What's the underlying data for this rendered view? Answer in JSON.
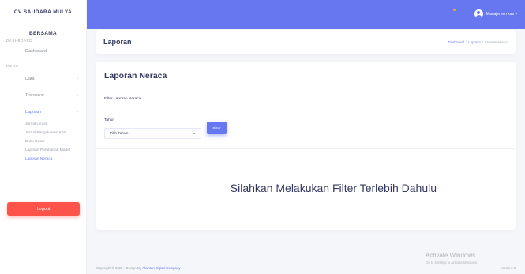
{
  "sidebar": {
    "brand": "CV SAUDARA MULYA",
    "brand_sub": "BERSAMA",
    "header_dashboard": "DASHBOARD",
    "header_menu": "MENU",
    "items": [
      {
        "label": "Dashboard",
        "has_chevron": false
      },
      {
        "label": "Data",
        "has_chevron": true
      },
      {
        "label": "Transaksi",
        "has_chevron": true
      },
      {
        "label": "Laporan",
        "has_chevron": true
      }
    ],
    "laporan_sub": [
      "Jurnal Umum",
      "Jurnal Pengeluaran Kas",
      "Buku Besar",
      "Laporan Perubahan Modal",
      "Laporan Neraca"
    ],
    "logout_label": "Logout"
  },
  "topbar": {
    "user_label": "Manajemen kas ▾"
  },
  "section": {
    "title": "Laporan",
    "breadcrumb": [
      "Dashboard",
      "Laporan",
      "Laporan Neraca"
    ]
  },
  "card": {
    "title": "Laporan Neraca",
    "filter_label": "Filter Laporan Neraca",
    "tahun_label": "Tahun",
    "select_value": "Pilih Tahun",
    "filter_button": "Filter",
    "message": "Silahkan Melakukan Filter Terlebih Dahulu"
  },
  "footer": {
    "copyright": "Copyright © 2022",
    "dot": "•",
    "design_by": "Design By",
    "company": "Akuntan Digital Company",
    "version": "Versio 1.0"
  },
  "watermark": {
    "title": "Activate Windows",
    "subtitle": "Go to Settings to activate Windows."
  },
  "colors": {
    "primary": "#6777ef",
    "danger": "#fc544b",
    "background": "#f4f6f9"
  }
}
